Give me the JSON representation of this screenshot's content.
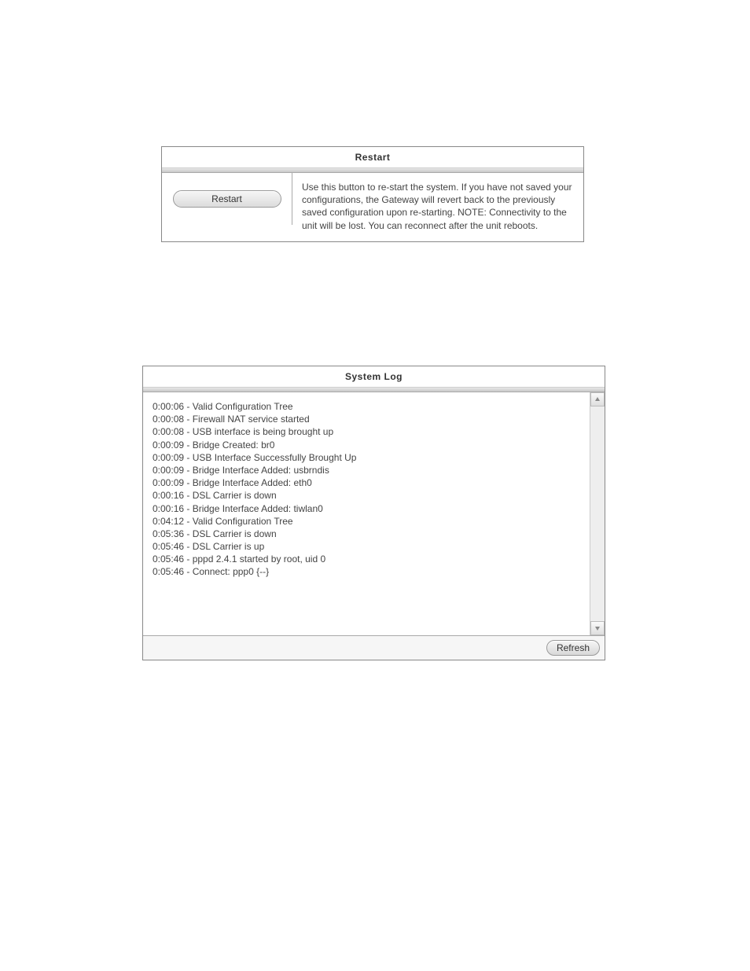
{
  "restart": {
    "title": "Restart",
    "button_label": "Restart",
    "description": "Use this button to re-start the system. If you have not saved your configurations, the Gateway will revert back to the previously saved configuration upon re-starting. NOTE: Connectivity to the unit will be lost. You can reconnect after the unit reboots."
  },
  "syslog": {
    "title": "System Log",
    "refresh_label": "Refresh",
    "entries": [
      "0:00:06 - Valid Configuration Tree",
      "0:00:08 - Firewall NAT service started",
      "0:00:08 - USB interface is being brought up",
      "0:00:09 - Bridge Created: br0",
      "0:00:09 - USB Interface Successfully Brought Up",
      "0:00:09 - Bridge Interface Added: usbrndis",
      "0:00:09 - Bridge Interface Added: eth0",
      "0:00:16 - DSL Carrier is down",
      "0:00:16 - Bridge Interface Added: tiwlan0",
      "0:04:12 - Valid Configuration Tree",
      "0:05:36 - DSL Carrier is down",
      "0:05:46 - DSL Carrier is up",
      "0:05:46 - pppd 2.4.1 started by root, uid 0",
      "0:05:46 - Connect: ppp0 {--}"
    ]
  }
}
